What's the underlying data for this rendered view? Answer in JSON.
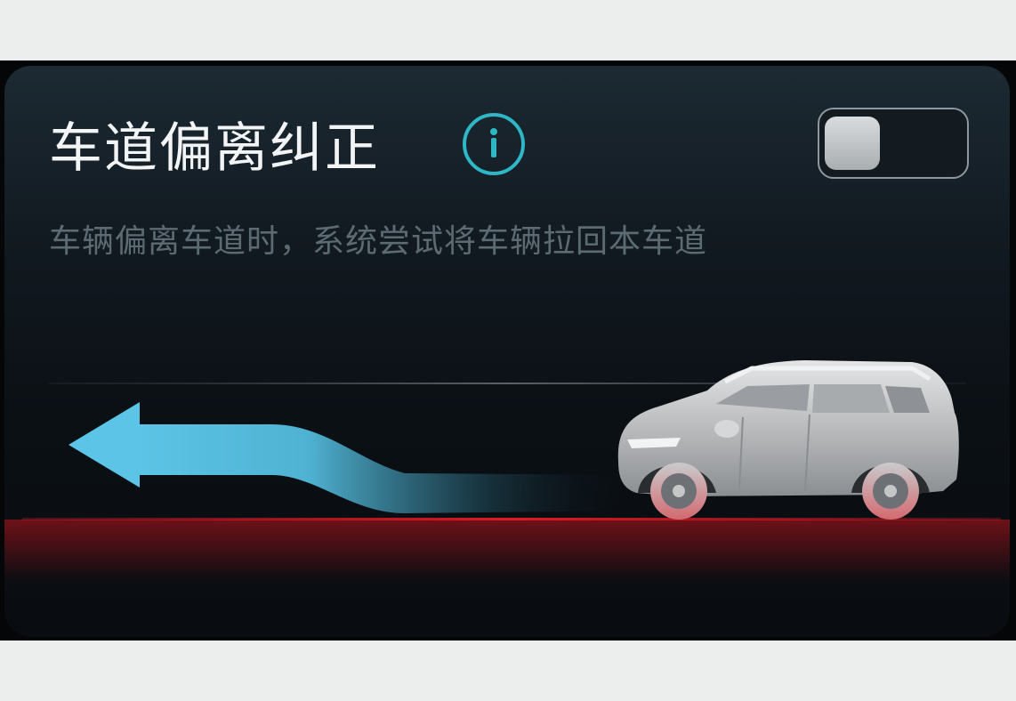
{
  "feature": {
    "title": "车道偏离纠正",
    "description": "车辆偏离车道时，系统尝试将车辆拉回本车道",
    "toggle_on": false
  },
  "icons": {
    "info": "info-icon",
    "arrow": "lane-return-arrow-icon",
    "car": "suv-car-icon"
  },
  "colors": {
    "accent": "#2fb7c5",
    "arrow": "#5cc4e6",
    "lane_warning": "#d51822"
  }
}
